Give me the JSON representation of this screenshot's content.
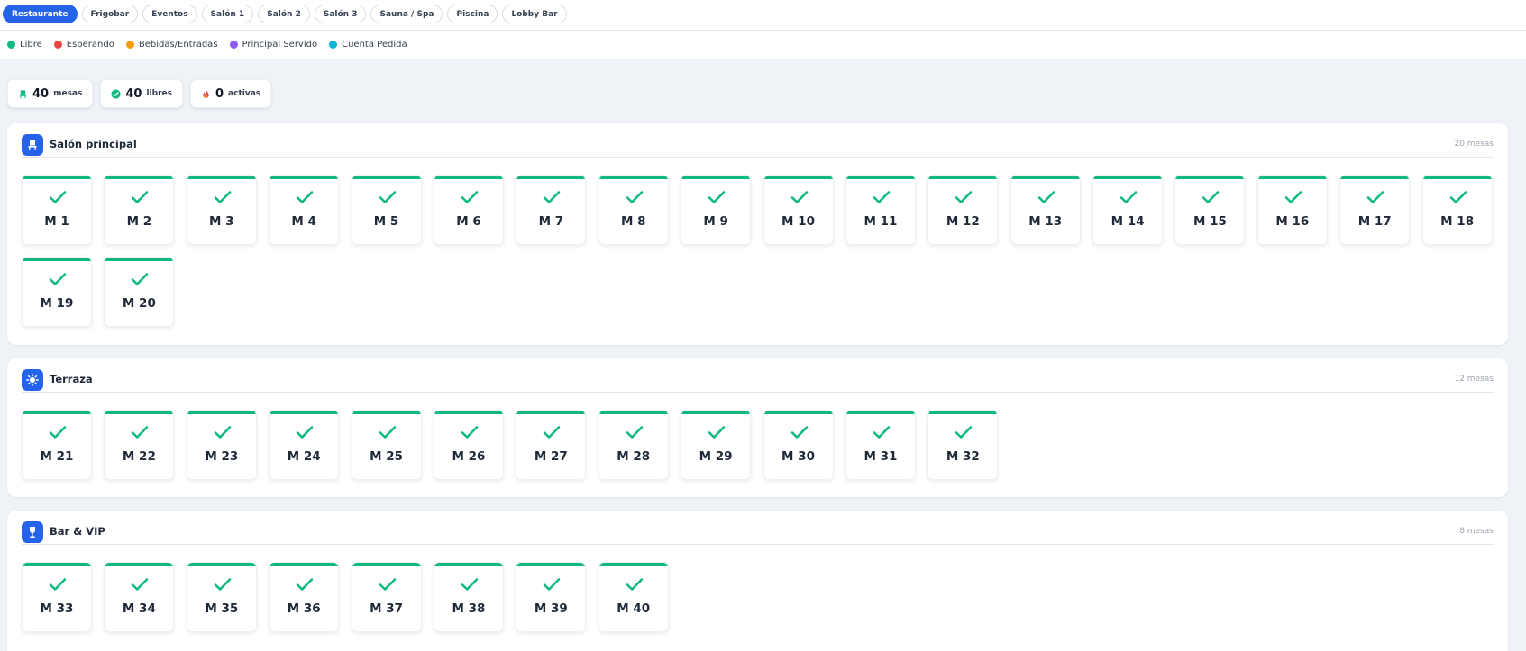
{
  "tabs": [
    "Restaurante",
    "Frigobar",
    "Eventos",
    "Salón 1",
    "Salón 2",
    "Salón 3",
    "Sauna / Spa",
    "Piscina",
    "Lobby Bar"
  ],
  "active_tab": "Restaurante",
  "legend": [
    {
      "label": "Libre",
      "color": "#10b981"
    },
    {
      "label": "Esperando",
      "color": "#ef4444"
    },
    {
      "label": "Bebidas/Entradas",
      "color": "#f59e0b"
    },
    {
      "label": "Principal Servido",
      "color": "#8b5cf6"
    },
    {
      "label": "Cuenta Pedida",
      "color": "#06b6d4"
    }
  ],
  "stats": [
    {
      "icon": "chair-icon",
      "value": "40",
      "label": "mesas"
    },
    {
      "icon": "check-circle-icon",
      "value": "40",
      "label": "libres"
    },
    {
      "icon": "flame-icon",
      "value": "0",
      "label": "activas"
    }
  ],
  "sections": [
    {
      "title": "Salón principal",
      "icon": "chair-icon",
      "count": "20 mesas",
      "tables": [
        "M 1",
        "M 2",
        "M 3",
        "M 4",
        "M 5",
        "M 6",
        "M 7",
        "M 8",
        "M 9",
        "M 10",
        "M 11",
        "M 12",
        "M 13",
        "M 14",
        "M 15",
        "M 16",
        "M 17",
        "M 18",
        "M 19",
        "M 20"
      ]
    },
    {
      "title": "Terraza",
      "icon": "sun-icon",
      "count": "12 mesas",
      "tables": [
        "M 21",
        "M 22",
        "M 23",
        "M 24",
        "M 25",
        "M 26",
        "M 27",
        "M 28",
        "M 29",
        "M 30",
        "M 31",
        "M 32"
      ]
    },
    {
      "title": "Bar & VIP",
      "icon": "wine-glass-icon",
      "count": "8 mesas",
      "tables": [
        "M 33",
        "M 34",
        "M 35",
        "M 36",
        "M 37",
        "M 38",
        "M 39",
        "M 40"
      ]
    }
  ],
  "colors": {
    "accent": "#2563eb",
    "free": "#10b981"
  }
}
